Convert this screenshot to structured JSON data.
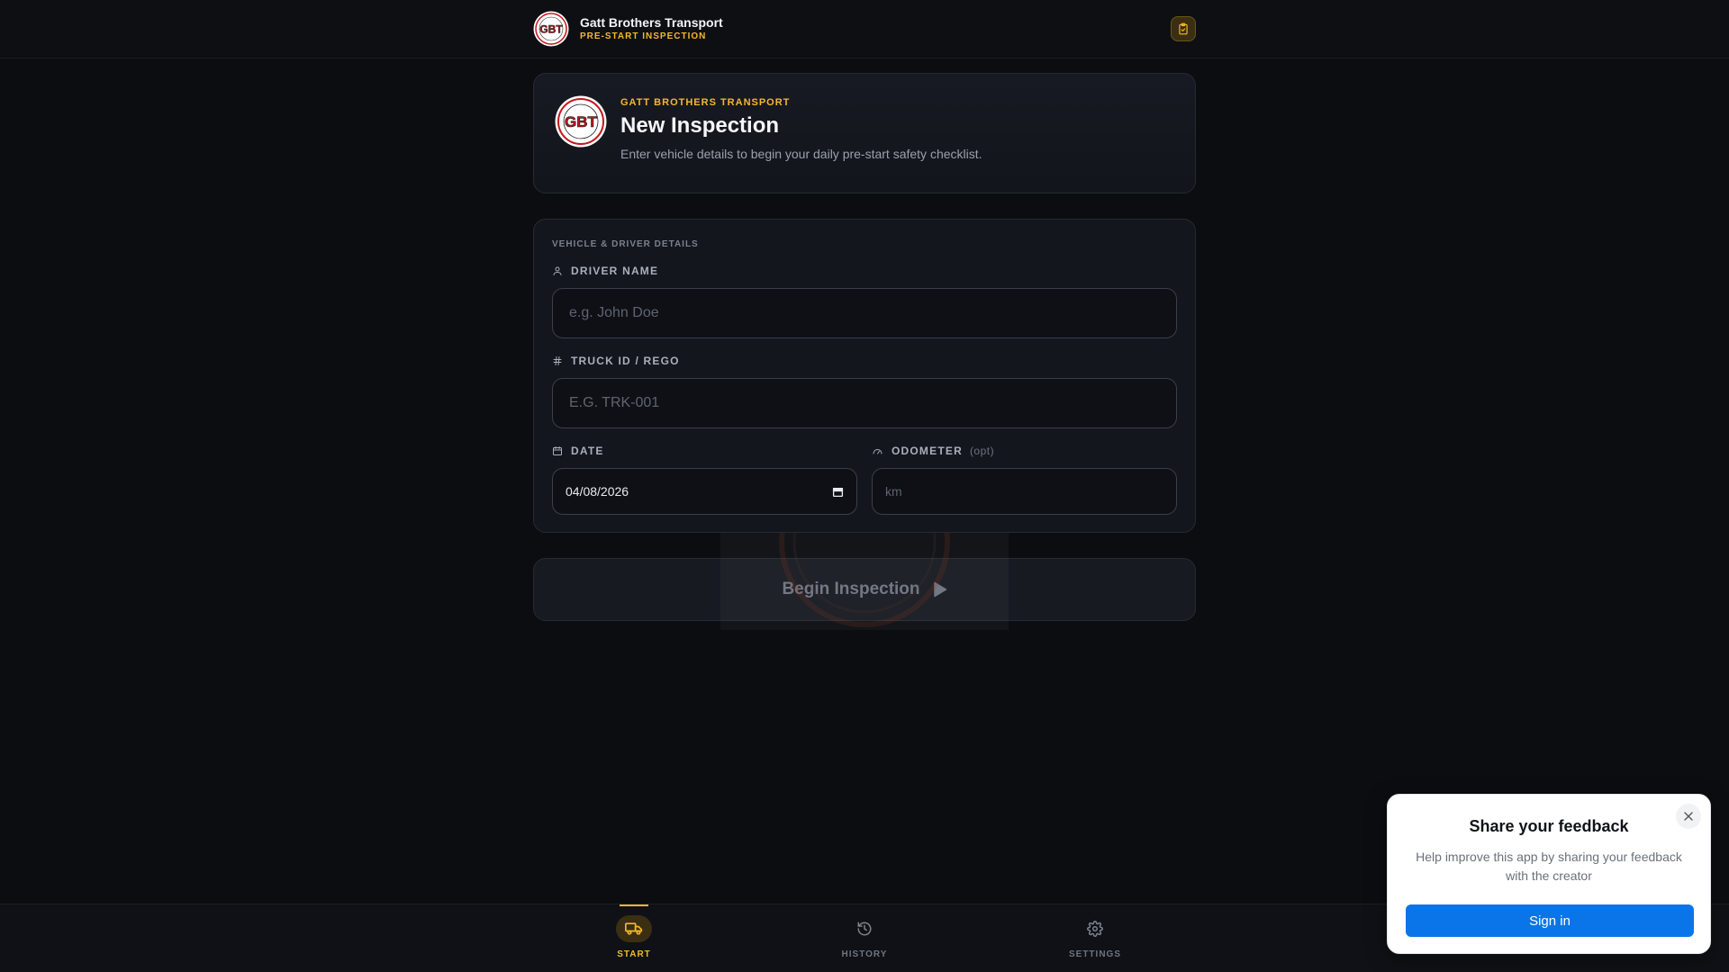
{
  "header": {
    "brand_name": "Gatt Brothers Transport",
    "brand_sub": "PRE-START INSPECTION",
    "logo_text": "GBT",
    "action_icon": "clipboard-check-icon"
  },
  "hero": {
    "kicker": "GATT BROTHERS TRANSPORT",
    "title": "New Inspection",
    "description": "Enter vehicle details to begin your daily pre-start safety checklist."
  },
  "form": {
    "section_label": "VEHICLE & DRIVER DETAILS",
    "driver_name": {
      "label": "DRIVER NAME",
      "placeholder": "e.g. John Doe",
      "value": "",
      "icon": "user-icon"
    },
    "truck_id": {
      "label": "TRUCK ID / REGO",
      "placeholder": "E.G. TRK-001",
      "value": "",
      "icon": "hash-icon"
    },
    "date": {
      "label": "DATE",
      "value": "04/08/2026",
      "icon": "calendar-icon"
    },
    "odometer": {
      "label": "ODOMETER",
      "optional_note": "(opt)",
      "placeholder": "km",
      "value": "",
      "icon": "gauge-icon"
    }
  },
  "begin_button": {
    "label": "Begin Inspection",
    "icon": "play-icon"
  },
  "bottom_nav": {
    "items": [
      {
        "label": "START",
        "icon": "truck-icon",
        "active": true
      },
      {
        "label": "HISTORY",
        "icon": "history-icon",
        "active": false
      },
      {
        "label": "SETTINGS",
        "icon": "gear-icon",
        "active": false
      }
    ]
  },
  "feedback": {
    "title": "Share your feedback",
    "description": "Help improve this app by sharing your feedback with the creator",
    "button_label": "Sign in",
    "close_icon": "close-icon"
  },
  "colors": {
    "background": "#0b0d11",
    "accent": "#f5b82e",
    "card": "#141720",
    "primary_button": "#0a75e8"
  }
}
